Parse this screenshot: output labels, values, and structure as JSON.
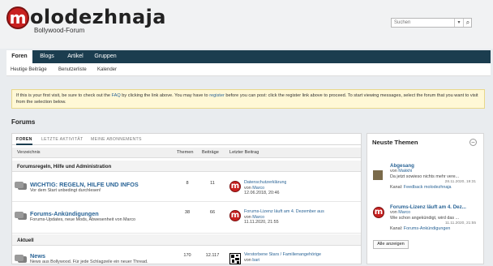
{
  "brand": {
    "logo_letter": "m",
    "logo_text": "olodezhnaja",
    "subtitle": "Bollywood-Forum"
  },
  "search": {
    "placeholder": "Suchen",
    "dropdown_icon": "chevron-down-icon",
    "button_icon": "search-icon"
  },
  "nav": {
    "tabs": [
      {
        "label": "Foren"
      },
      {
        "label": "Blogs"
      },
      {
        "label": "Artikel"
      },
      {
        "label": "Gruppen"
      }
    ]
  },
  "subnav": {
    "items": [
      {
        "label": "Heutige Beiträge"
      },
      {
        "label": "Benutzerliste"
      },
      {
        "label": "Kalender"
      }
    ]
  },
  "notice": {
    "p1": "If this is your first visit, be sure to check out the ",
    "faq": "FAQ",
    "p2": " by clicking the link above. You may have to ",
    "register": "register",
    "p3": " before you can post: click the register link above to proceed. To start viewing messages, select the forum that you want to visit from the selection below."
  },
  "forums_title": "Forums",
  "panel": {
    "tabs": [
      {
        "label": "FOREN"
      },
      {
        "label": "LETZTE AKTIVITÄT"
      },
      {
        "label": "MEINE ABONNEMENTS"
      }
    ],
    "columns": {
      "directory": "Verzeichnis",
      "topics": "Themen",
      "posts": "Beiträge",
      "last_post": "Letzter Beitrag"
    },
    "sections": [
      {
        "title": "Forumsregeln, Hilfe und Administration"
      },
      {
        "title": "Aktuell"
      }
    ],
    "forums": [
      {
        "title": "WICHTIG: REGELN, HILFE UND INFOS",
        "desc": "Vor dem Start unbedingt durchlesen!",
        "topics": "8",
        "posts": "11",
        "lp_title": "Datenschutzerklärung",
        "lp_by": "von",
        "lp_user": "Marco",
        "lp_date": "12.06.2018, 20:46"
      },
      {
        "title": "Forums-Ankündigungen",
        "desc": "Forums-Updates, neue Mods, Abwesenheit von Marco",
        "topics": "38",
        "posts": "66",
        "lp_title": "Forums-Lizenz läuft am 4. Dezember aus",
        "lp_by": "von",
        "lp_user": "Marco",
        "lp_date": "11.11.2020, 21:55"
      },
      {
        "title": "News",
        "desc": "News aus Bollywood. Für jede Schlagzeile ein neuer Thread.",
        "topics": "170",
        "posts": "12.117",
        "lp_title": "Verstorbene Stars / Familienangehörige",
        "lp_by": "von",
        "lp_user": "bari",
        "lp_date": ""
      }
    ]
  },
  "sidebar": {
    "title": "Neuste Themen",
    "toggle_icon": "collapse-icon",
    "items": [
      {
        "title": "Abgesang",
        "by": "von",
        "user": "Makkhi",
        "excerpt": "Da jetzt sowieso nichts mehr vere...",
        "date": "28.11.2020, 19:31",
        "channel_label": "Kanal:",
        "channel": "Feedback molodezhnaja"
      },
      {
        "title": "Forums-Lizenz läuft am 4. Dez...",
        "by": "von",
        "user": "Marco",
        "excerpt": "Wie schon angekündigt, wird das ...",
        "date": "11.11.2020, 21:55",
        "channel_label": "Kanal:",
        "channel": "Forums-Ankündigungen"
      }
    ],
    "show_all": "Alle anzeigen"
  }
}
